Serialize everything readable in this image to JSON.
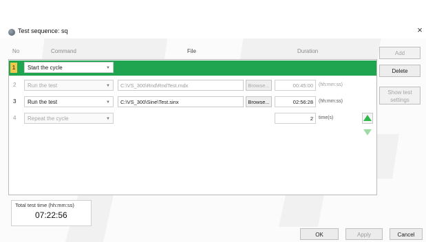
{
  "window": {
    "title": "Test sequence: sq",
    "close_glyph": "×"
  },
  "headers": {
    "no": "No",
    "command": "Command",
    "file": "File",
    "duration": "Duration"
  },
  "rows": [
    {
      "no": "1",
      "command": "Start the cycle",
      "selected": true,
      "enabled": true
    },
    {
      "no": "2",
      "command": "Run the test",
      "file": "C:\\VS_300\\Rnd\\RndTest.rndx",
      "browse": "Browse...",
      "duration": "00:45:00",
      "unit": "(hh:mm:ss)",
      "enabled": false
    },
    {
      "no": "3",
      "command": "Run the test",
      "file": "C:\\VS_300\\Sine\\Test.sinx",
      "browse": "Browse...",
      "duration": "02:56:28",
      "unit": "(hh:mm:ss)",
      "enabled": true
    },
    {
      "no": "4",
      "command": "Repeat the cycle",
      "duration": "2",
      "unit": "time(s)",
      "enabled": false
    }
  ],
  "buttons": {
    "add": "Add",
    "delete": "Delete",
    "show_test_settings_1": "Show test",
    "show_test_settings_2": "settings",
    "ok": "OK",
    "apply": "Apply",
    "cancel": "Cancel"
  },
  "total": {
    "label": "Total test time (hh:mm:ss)",
    "value": "07:22:56"
  },
  "colors": {
    "selected_row": "#1fa54f",
    "row_marker": "#f0c84b",
    "arrow_up": "#2fb84a",
    "arrow_down": "#9fdca5"
  },
  "icons": {
    "move_up": "triangle-up-icon",
    "move_down": "triangle-down-icon",
    "dropdown": "chevron-down-icon"
  }
}
